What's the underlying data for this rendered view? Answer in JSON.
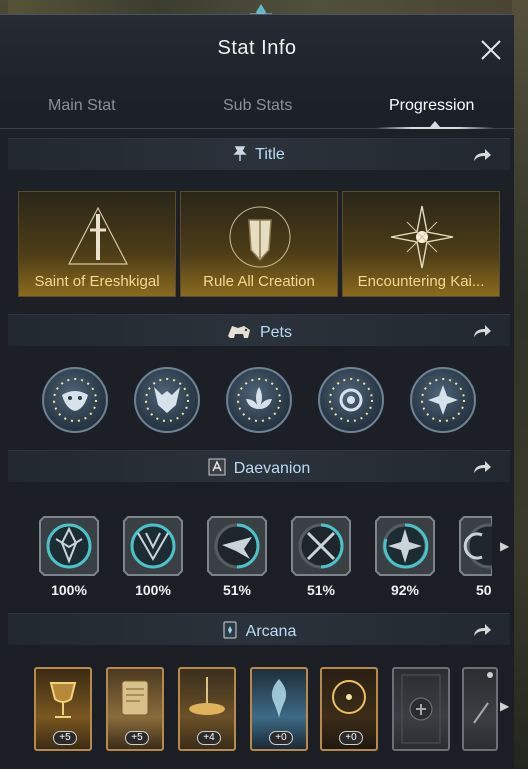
{
  "window": {
    "title": "Stat Info",
    "close_icon": "close-icon"
  },
  "tabs": [
    {
      "label": "Main Stat",
      "active": false
    },
    {
      "label": "Sub Stats",
      "active": false
    },
    {
      "label": "Progression",
      "active": true
    }
  ],
  "sections": {
    "title": {
      "label": "Title",
      "icon": "pin-icon"
    },
    "pets": {
      "label": "Pets",
      "icon": "pet-icon"
    },
    "daevanion": {
      "label": "Daevanion",
      "icon": "rune-icon"
    },
    "arcana": {
      "label": "Arcana",
      "icon": "card-icon"
    }
  },
  "titles": [
    {
      "label": "Saint of Ereshkigal",
      "icon": "sword-triangle-icon"
    },
    {
      "label": "Rule All Creation",
      "icon": "shield-emblem-icon"
    },
    {
      "label": "Encountering Kai...",
      "icon": "star-compass-icon"
    }
  ],
  "pets": [
    {
      "icon": "mask-icon"
    },
    {
      "icon": "wolf-icon"
    },
    {
      "icon": "lotus-icon"
    },
    {
      "icon": "eye-icon"
    },
    {
      "icon": "leaf-star-icon"
    }
  ],
  "daevanion": [
    {
      "icon": "wing-emblem-icon",
      "percent": "100%"
    },
    {
      "icon": "wing-crest-icon",
      "percent": "100%"
    },
    {
      "icon": "bird-icon",
      "percent": "51%"
    },
    {
      "icon": "crossed-swords-icon",
      "percent": "51%"
    },
    {
      "icon": "compass-star-icon",
      "percent": "92%"
    },
    {
      "icon": "moon-icon",
      "percent": "50"
    }
  ],
  "arcana": [
    {
      "icon": "chalice-card-icon",
      "level": "+5",
      "frame": "gold"
    },
    {
      "icon": "scroll-card-icon",
      "level": "+5",
      "frame": "gold"
    },
    {
      "icon": "treasure-card-icon",
      "level": "+4",
      "frame": "gold"
    },
    {
      "icon": "spirit-card-icon",
      "level": "+0",
      "frame": "gold"
    },
    {
      "icon": "ring-card-icon",
      "level": "+0",
      "frame": "gold"
    },
    {
      "icon": "locked-card-icon",
      "level": "",
      "frame": "gray"
    },
    {
      "icon": "locked-card-icon",
      "level": "",
      "frame": "gray"
    }
  ],
  "colors": {
    "accent_text": "#b7ddf6",
    "title_gold": "#f3d992",
    "panel_bg": "#1b1e24"
  }
}
